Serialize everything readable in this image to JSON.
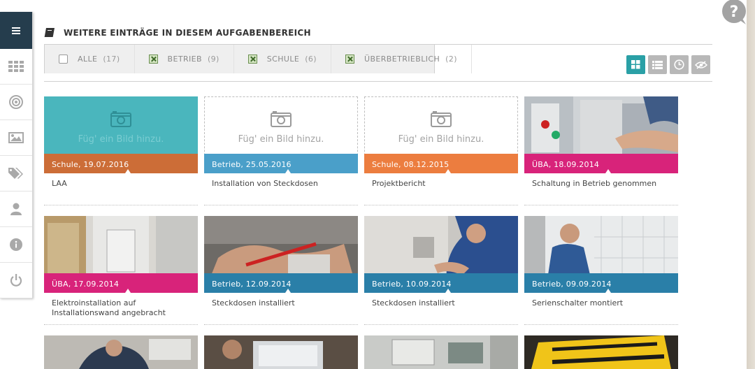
{
  "help": {
    "glyph": "?"
  },
  "sidebar": {
    "items": [
      {
        "icon": "menu-icon"
      },
      {
        "icon": "grid-icon"
      },
      {
        "icon": "target-icon"
      },
      {
        "icon": "image-icon"
      },
      {
        "icon": "tags-icon"
      },
      {
        "icon": "user-icon"
      },
      {
        "icon": "info-icon"
      },
      {
        "icon": "power-icon"
      }
    ]
  },
  "header": {
    "title": "WEITERE EINTRÄGE IN DIESEM AUFGABENBEREICH",
    "icon": "book-icon"
  },
  "filters": [
    {
      "label": "ALLE",
      "count": "(17)",
      "checked": false
    },
    {
      "label": "BETRIEB",
      "count": "(9)",
      "checked": true
    },
    {
      "label": "SCHULE",
      "count": "(6)",
      "checked": true
    },
    {
      "label": "ÜBERBETRIEBLICH",
      "count": "(2)",
      "checked": true
    }
  ],
  "views": [
    {
      "icon": "tile-view-icon",
      "active": true
    },
    {
      "icon": "list-view-icon",
      "active": false
    },
    {
      "icon": "clock-view-icon",
      "active": false
    },
    {
      "icon": "visibility-icon",
      "active": false
    }
  ],
  "placeholder_text": "Füg' ein Bild hinzu.",
  "colors": {
    "schule": "#cc6d37",
    "schule_alt": "#ec7d3f",
    "betrieb": "#4a9fc9",
    "betrieb_dark": "#2a7fa8",
    "uba": "#d8237a",
    "teal": "#2aa0a6"
  },
  "cards": [
    {
      "label": "Schule, 19.07.2016",
      "title": "LAA",
      "image": "placeholder-filled"
    },
    {
      "label": "Betrieb, 25.05.2016",
      "title": "Installation von Steckdosen",
      "image": "placeholder"
    },
    {
      "label": "Schule, 08.12.2015",
      "title": "Projektbericht",
      "image": "placeholder"
    },
    {
      "label": "ÜBA, 18.09.2014",
      "title": "Schaltung in Betrieb genommen",
      "image": "photo"
    },
    {
      "label": "ÜBA, 17.09.2014",
      "title": "Elektroinstallation auf Installationswand angebracht",
      "image": "photo"
    },
    {
      "label": "Betrieb, 12.09.2014",
      "title": "Steckdosen installiert",
      "image": "photo"
    },
    {
      "label": "Betrieb, 10.09.2014",
      "title": "Steckdosen installiert",
      "image": "photo"
    },
    {
      "label": "Betrieb, 09.09.2014",
      "title": "Serienschalter montiert",
      "image": "photo"
    }
  ],
  "bottom_row_images": [
    "photo",
    "photo",
    "photo",
    "photo"
  ]
}
